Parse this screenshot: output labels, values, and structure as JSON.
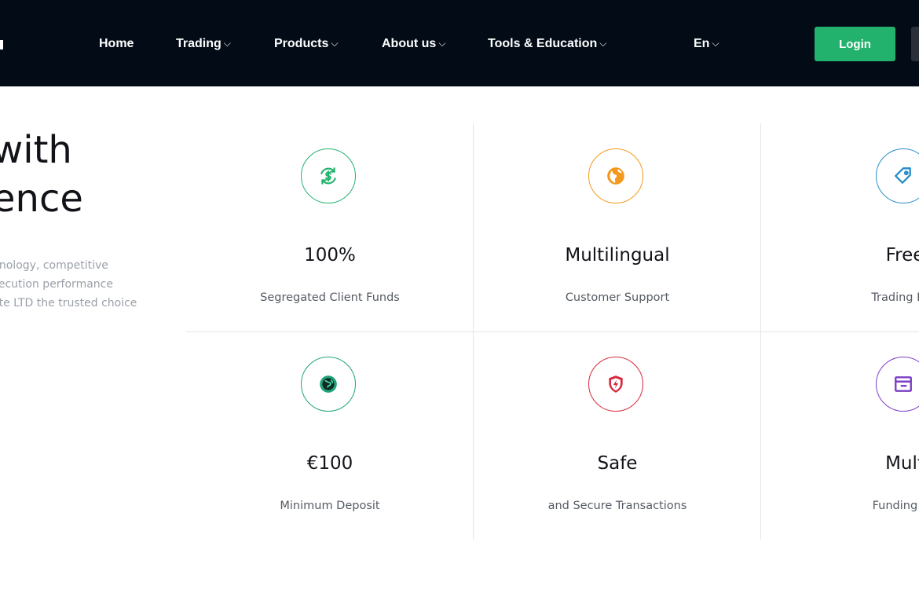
{
  "nav": {
    "items": [
      {
        "label": "Home",
        "has_dropdown": false
      },
      {
        "label": "Trading",
        "has_dropdown": true
      },
      {
        "label": "Products",
        "has_dropdown": true
      },
      {
        "label": "About us",
        "has_dropdown": true
      },
      {
        "label": "Tools & Education",
        "has_dropdown": true
      },
      {
        "label": "En",
        "has_dropdown": true
      }
    ],
    "chevron": "⌵",
    "login_label": "Login"
  },
  "hero": {
    "title_lines": [
      "with",
      "ence"
    ],
    "description_lines": [
      "nnology, competitive",
      "xecution performance",
      "ate LTD the trusted choice"
    ]
  },
  "features": [
    {
      "icon": "dollar-refresh-icon",
      "color": "#23b26d",
      "title": "100%",
      "subtitle": "Segregated Client Funds"
    },
    {
      "icon": "globe-icon",
      "color": "#f39a1e",
      "title": "Multilingual",
      "subtitle": "Customer Support"
    },
    {
      "icon": "tag-icon",
      "color": "#2a8fc9",
      "title": "Free",
      "subtitle": "Trading Edu"
    },
    {
      "icon": "coin-icon",
      "color": "#1fa37a",
      "title": "€100",
      "subtitle": "Minimum Deposit"
    },
    {
      "icon": "shield-bolt-icon",
      "color": "#d6293e",
      "title": "Safe",
      "subtitle": "and Secure Transactions"
    },
    {
      "icon": "wallet-icon",
      "color": "#7b3fc4",
      "title": "Mult",
      "subtitle": "Funding Op"
    }
  ]
}
